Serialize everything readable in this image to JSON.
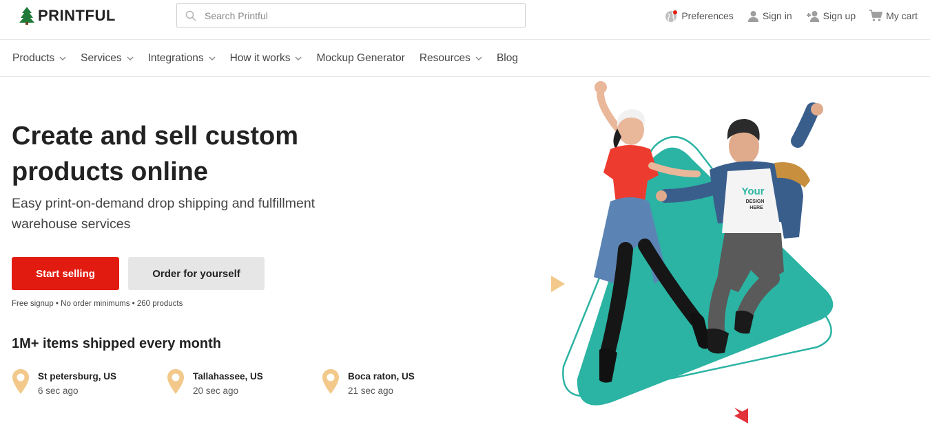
{
  "header": {
    "brand": "PRINTFUL",
    "search": {
      "placeholder": "Search Printful",
      "value": ""
    },
    "links": {
      "preferences": "Preferences",
      "sign_in": "Sign in",
      "sign_up": "Sign up",
      "cart": "My cart"
    }
  },
  "nav": {
    "items": [
      {
        "label": "Products",
        "has_dropdown": true
      },
      {
        "label": "Services",
        "has_dropdown": true
      },
      {
        "label": "Integrations",
        "has_dropdown": true
      },
      {
        "label": "How it works",
        "has_dropdown": true
      },
      {
        "label": "Mockup Generator",
        "has_dropdown": false
      },
      {
        "label": "Resources",
        "has_dropdown": true
      },
      {
        "label": "Blog",
        "has_dropdown": false
      }
    ]
  },
  "hero": {
    "title_line1": "Create and sell custom",
    "title_line2": "products online",
    "subtitle_line1": "Easy print-on-demand drop shipping and fulfillment",
    "subtitle_line2": "warehouse services",
    "primary_button": "Start selling",
    "secondary_button": "Order for yourself",
    "perks": "Free signup • No order minimums • 260 products",
    "shirt_text_line1": "Your",
    "shirt_text_line2": "DESIGN",
    "shirt_text_line3": "HERE"
  },
  "shipping": {
    "headline": "1M+ items shipped every month",
    "recent": [
      {
        "city": "St petersburg, US",
        "time": "6 sec ago"
      },
      {
        "city": "Tallahassee, US",
        "time": "20 sec ago"
      },
      {
        "city": "Boca raton, US",
        "time": "21 sec ago"
      }
    ]
  },
  "colors": {
    "brand_red": "#e21b10",
    "teal": "#2bb3a3",
    "pin_gold": "#f2c98a",
    "secondary_button_bg": "#e6e6e6"
  },
  "icons": {
    "logo": "tree-logo-icon",
    "search": "search-icon",
    "preferences": "globe-icon",
    "sign_in": "user-icon",
    "sign_up": "add-user-icon",
    "cart": "cart-icon",
    "dropdown": "chevron-down-icon",
    "location": "map-pin-icon"
  }
}
